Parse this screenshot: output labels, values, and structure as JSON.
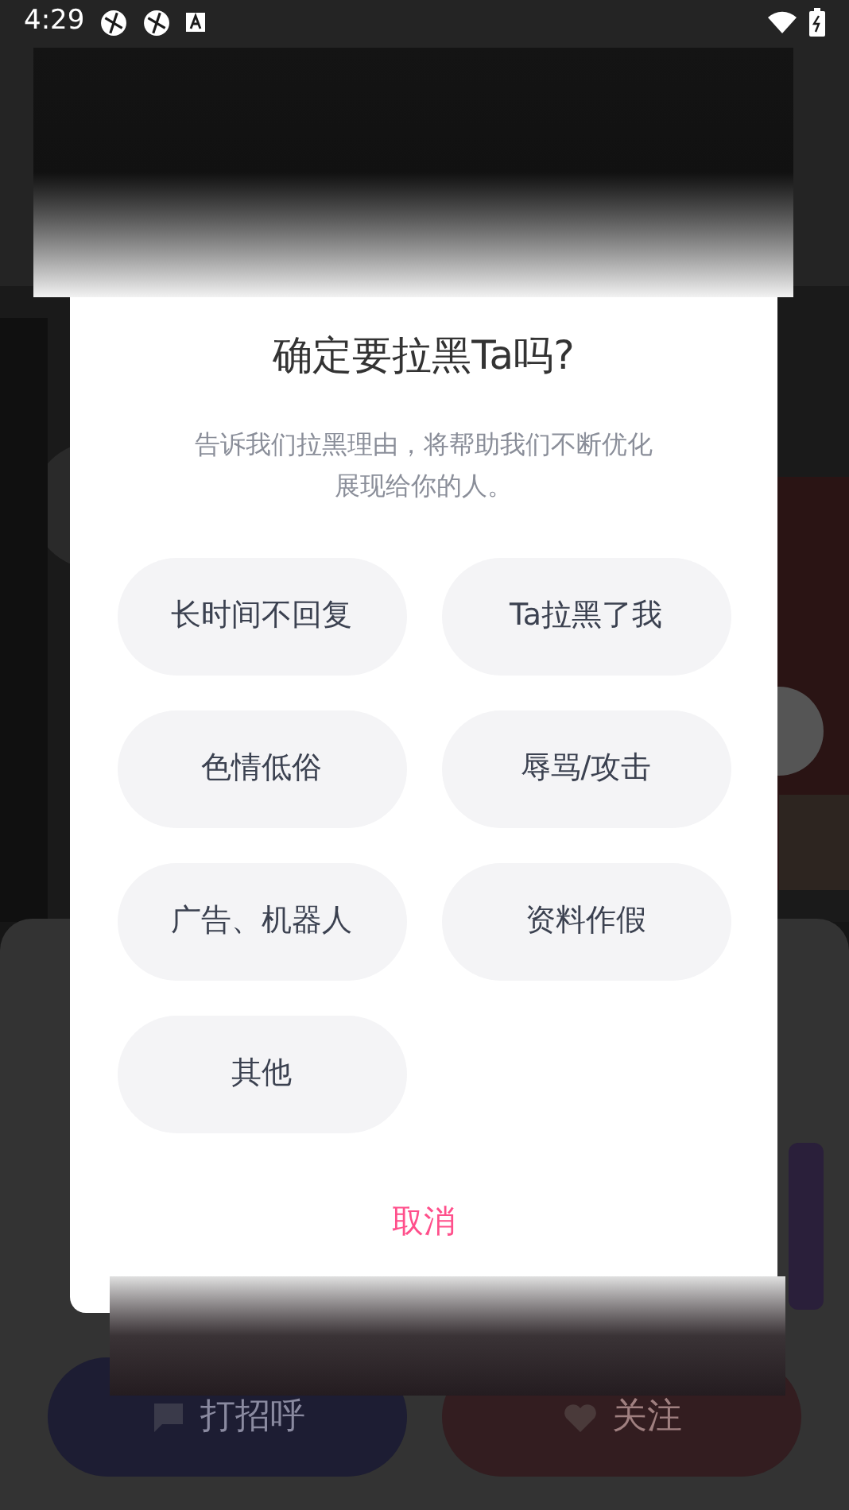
{
  "status_bar": {
    "time": "4:29"
  },
  "background": {
    "buttons": [
      {
        "label": "打招呼",
        "kind": "greet"
      },
      {
        "label": "关注",
        "kind": "follow"
      }
    ]
  },
  "dialog": {
    "title": "确定要拉黑Ta吗?",
    "message": "告诉我们拉黑理由，将帮助我们不断优化展现给你的人。",
    "reasons": [
      {
        "label": "长时间不回复",
        "selected": false
      },
      {
        "label": "Ta拉黑了我",
        "selected": false
      },
      {
        "label": "色情低俗",
        "selected": false
      },
      {
        "label": "辱骂/攻击",
        "selected": false
      },
      {
        "label": "广告、机器人",
        "selected": false
      },
      {
        "label": "资料作假",
        "selected": false
      },
      {
        "label": "其他",
        "selected": false
      }
    ],
    "cancel": "取消"
  }
}
